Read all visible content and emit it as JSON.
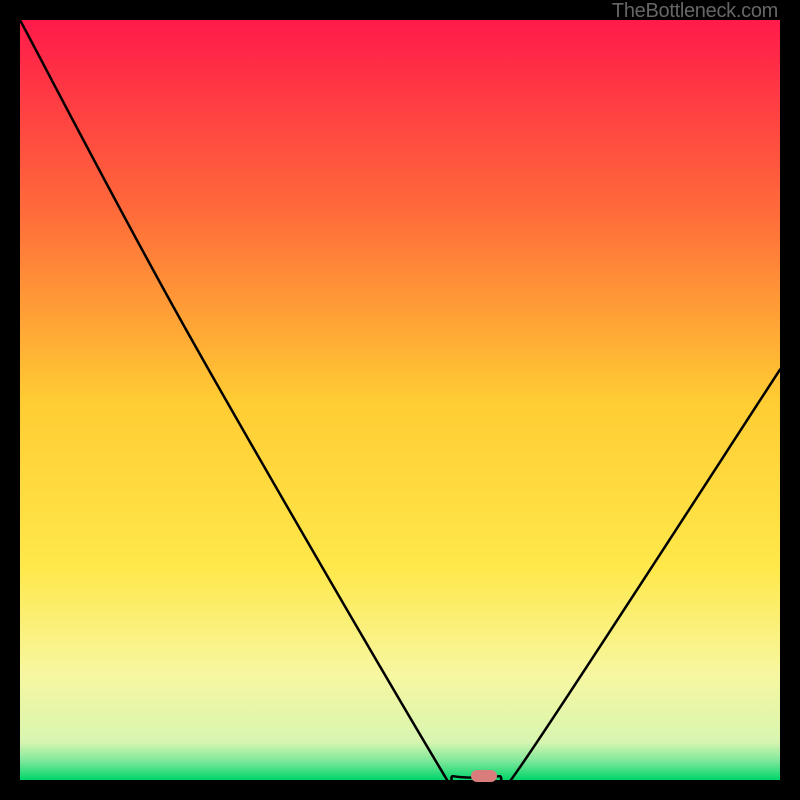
{
  "attribution": "TheBottleneck.com",
  "chart_data": {
    "type": "line",
    "title": "",
    "xlabel": "",
    "ylabel": "",
    "xlim": [
      0,
      100
    ],
    "ylim": [
      0,
      100
    ],
    "grid": false,
    "gradient_stops": [
      {
        "offset": 0,
        "color": "#ff1a4a"
      },
      {
        "offset": 0.25,
        "color": "#ff6a3a"
      },
      {
        "offset": 0.5,
        "color": "#ffcc33"
      },
      {
        "offset": 0.72,
        "color": "#ffe84a"
      },
      {
        "offset": 0.86,
        "color": "#f7f7a0"
      },
      {
        "offset": 0.95,
        "color": "#d8f5b0"
      },
      {
        "offset": 0.975,
        "color": "#7ee89a"
      },
      {
        "offset": 1.0,
        "color": "#00d56a"
      }
    ],
    "series": [
      {
        "name": "bottleneck-curve",
        "points": [
          {
            "x": 0,
            "y": 100
          },
          {
            "x": 22,
            "y": 59
          },
          {
            "x": 55,
            "y": 2
          },
          {
            "x": 57,
            "y": 0.5
          },
          {
            "x": 63,
            "y": 0.5
          },
          {
            "x": 66,
            "y": 2
          },
          {
            "x": 100,
            "y": 54
          }
        ]
      }
    ],
    "marker": {
      "x": 61,
      "y": 0.5,
      "color": "#d87c7c"
    }
  }
}
